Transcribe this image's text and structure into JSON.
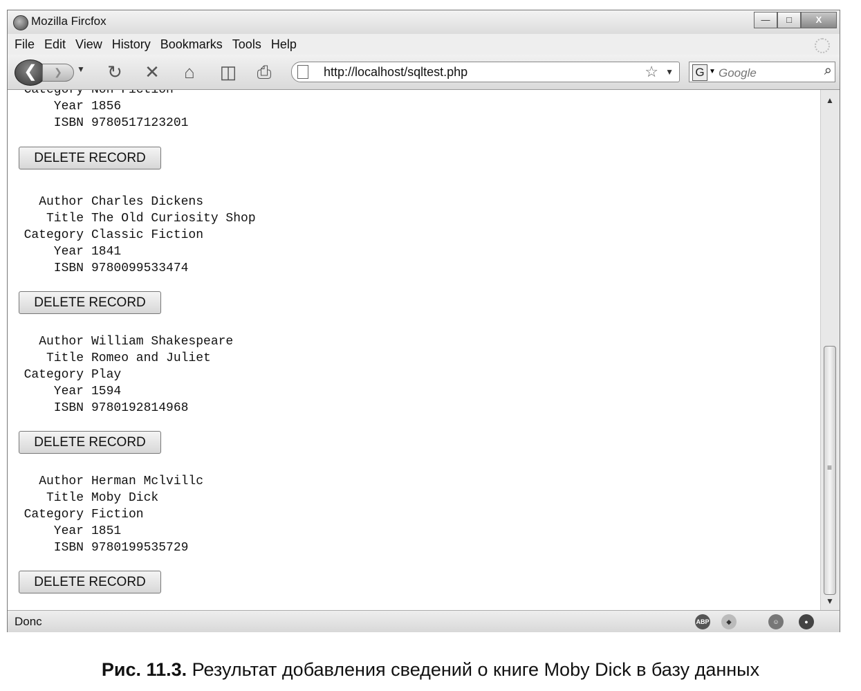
{
  "window": {
    "title": "Mozilla Fircfox"
  },
  "menu": [
    "File",
    "Edit",
    "View",
    "History",
    "Bookmarks",
    "Tools",
    "Help"
  ],
  "address": {
    "url": "http://localhost/sqltest.php"
  },
  "search": {
    "placeholder": "Google",
    "engine_letter": "G"
  },
  "records": [
    {
      "fields": [
        {
          "label": "Category",
          "value": "Non-Fiction"
        },
        {
          "label": "Year",
          "value": "1856"
        },
        {
          "label": "ISBN",
          "value": "9780517123201"
        }
      ],
      "button": "DELETE RECORD"
    },
    {
      "fields": [
        {
          "label": "Author",
          "value": "Charles Dickens"
        },
        {
          "label": "Title",
          "value": "The Old Curiosity Shop"
        },
        {
          "label": "Category",
          "value": "Classic Fiction"
        },
        {
          "label": "Year",
          "value": "1841"
        },
        {
          "label": "ISBN",
          "value": "9780099533474"
        }
      ],
      "button": "DELETE RECORD"
    },
    {
      "fields": [
        {
          "label": "Author",
          "value": "William Shakespeare"
        },
        {
          "label": "Title",
          "value": "Romeo and Juliet"
        },
        {
          "label": "Category",
          "value": "Play"
        },
        {
          "label": "Year",
          "value": "1594"
        },
        {
          "label": "ISBN",
          "value": "9780192814968"
        }
      ],
      "button": "DELETE RECORD"
    },
    {
      "fields": [
        {
          "label": "Author",
          "value": "Herman Mclvillc"
        },
        {
          "label": "Title",
          "value": "Moby Dick"
        },
        {
          "label": "Category",
          "value": "Fiction"
        },
        {
          "label": "Year",
          "value": "1851"
        },
        {
          "label": "ISBN",
          "value": "9780199535729"
        }
      ],
      "button": "DELETE RECORD"
    }
  ],
  "status": {
    "text": "Donc"
  },
  "caption": {
    "prefix": "Рис. 11.3.",
    "text": "Результат добавления сведений о книге Moby Dick в базу данных"
  }
}
